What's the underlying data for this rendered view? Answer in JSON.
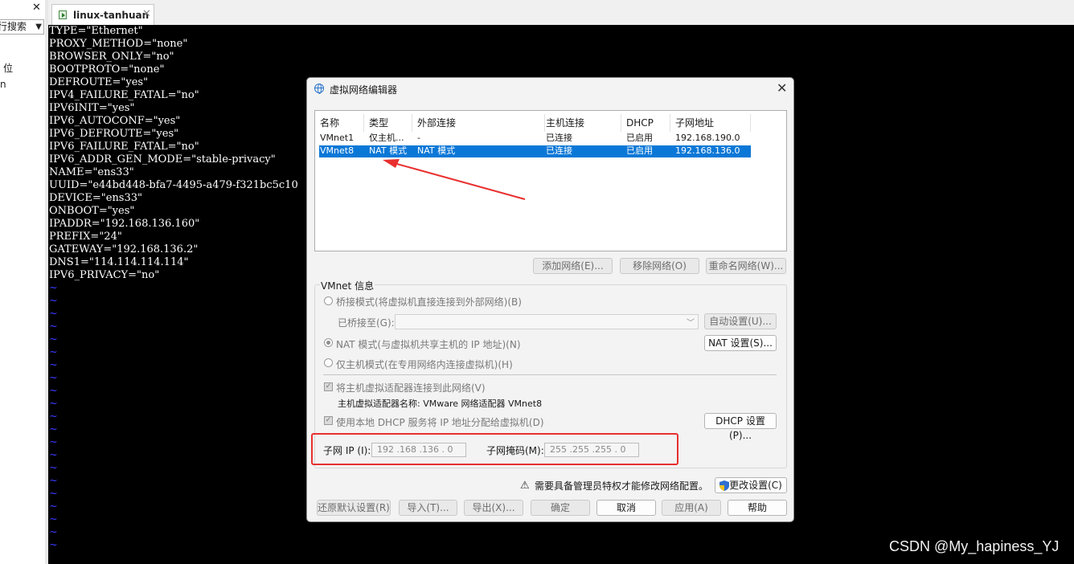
{
  "left_pane": {
    "search_label": "行搜索",
    "item1": "位",
    "item2": "n"
  },
  "tab": {
    "label": "linux-tanhuan"
  },
  "terminal": {
    "lines": [
      "TYPE=\"Ethernet\"",
      "PROXY_METHOD=\"none\"",
      "BROWSER_ONLY=\"no\"",
      "BOOTPROTO=\"none\"",
      "DEFROUTE=\"yes\"",
      "IPV4_FAILURE_FATAL=\"no\"",
      "IPV6INIT=\"yes\"",
      "IPV6_AUTOCONF=\"yes\"",
      "IPV6_DEFROUTE=\"yes\"",
      "IPV6_FAILURE_FATAL=\"no\"",
      "IPV6_ADDR_GEN_MODE=\"stable-privacy\"",
      "NAME=\"ens33\"",
      "UUID=\"e44bd448-bfa7-4495-a479-f321bc5c10",
      "DEVICE=\"ens33\"",
      "ONBOOT=\"yes\"",
      "IPADDR=\"192.168.136.160\"",
      "PREFIX=\"24\"",
      "GATEWAY=\"192.168.136.2\"",
      "DNS1=\"114.114.114.114\"",
      "IPV6_PRIVACY=\"no\""
    ],
    "tilde": "~"
  },
  "dialog": {
    "title": "虚拟网络编辑器",
    "close": "✕",
    "columns": {
      "name": "名称",
      "type": "类型",
      "external": "外部连接",
      "host": "主机连接",
      "dhcp": "DHCP",
      "subnet": "子网地址"
    },
    "rows": [
      {
        "name": "VMnet1",
        "type": "仅主机...",
        "external": "-",
        "host": "已连接",
        "dhcp": "已启用",
        "subnet": "192.168.190.0",
        "selected": false
      },
      {
        "name": "VMnet8",
        "type": "NAT 模式",
        "external": "NAT 模式",
        "host": "已连接",
        "dhcp": "已启用",
        "subnet": "192.168.136.0",
        "selected": true
      }
    ],
    "buttons": {
      "add_network": "添加网络(E)...",
      "remove_network": "移除网络(O)",
      "rename_network": "重命名网络(W)...",
      "auto_settings": "自动设置(U)...",
      "nat_settings": "NAT 设置(S)...",
      "dhcp_settings": "DHCP 设置(P)...",
      "change_settings": "更改设置(C)",
      "restore_defaults": "还原默认设置(R)",
      "import": "导入(T)...",
      "export": "导出(X)...",
      "ok": "确定",
      "cancel": "取消",
      "apply": "应用(A)",
      "help": "帮助"
    },
    "vmnet_info": {
      "group_label": "VMnet 信息",
      "bridged_mode": "桥接模式(将虚拟机直接连接到外部网络)(B)",
      "bridged_to_label": "已桥接至(G):",
      "nat_mode": "NAT 模式(与虚拟机共享主机的 IP 地址)(N)",
      "host_only_mode": "仅主机模式(在专用网络内连接虚拟机)(H)",
      "connect_adapter": "将主机虚拟适配器连接到此网络(V)",
      "adapter_name": "主机虚拟适配器名称: VMware 网络适配器 VMnet8",
      "use_dhcp": "使用本地 DHCP 服务将 IP 地址分配给虚拟机(D)",
      "subnet_ip_label": "子网 IP (I):",
      "subnet_ip_value": "192 .168 .136 . 0",
      "subnet_mask_label": "子网掩码(M):",
      "subnet_mask_value": "255 .255 .255 . 0",
      "selected_mode": "nat"
    },
    "admin_warning": "需要具备管理员特权才能修改网络配置。"
  },
  "watermark": "CSDN @My_hapiness_YJ",
  "colors": {
    "selection": "#0b78d7",
    "highlight_box": "#e8302f",
    "tilde": "#3a3aff"
  }
}
